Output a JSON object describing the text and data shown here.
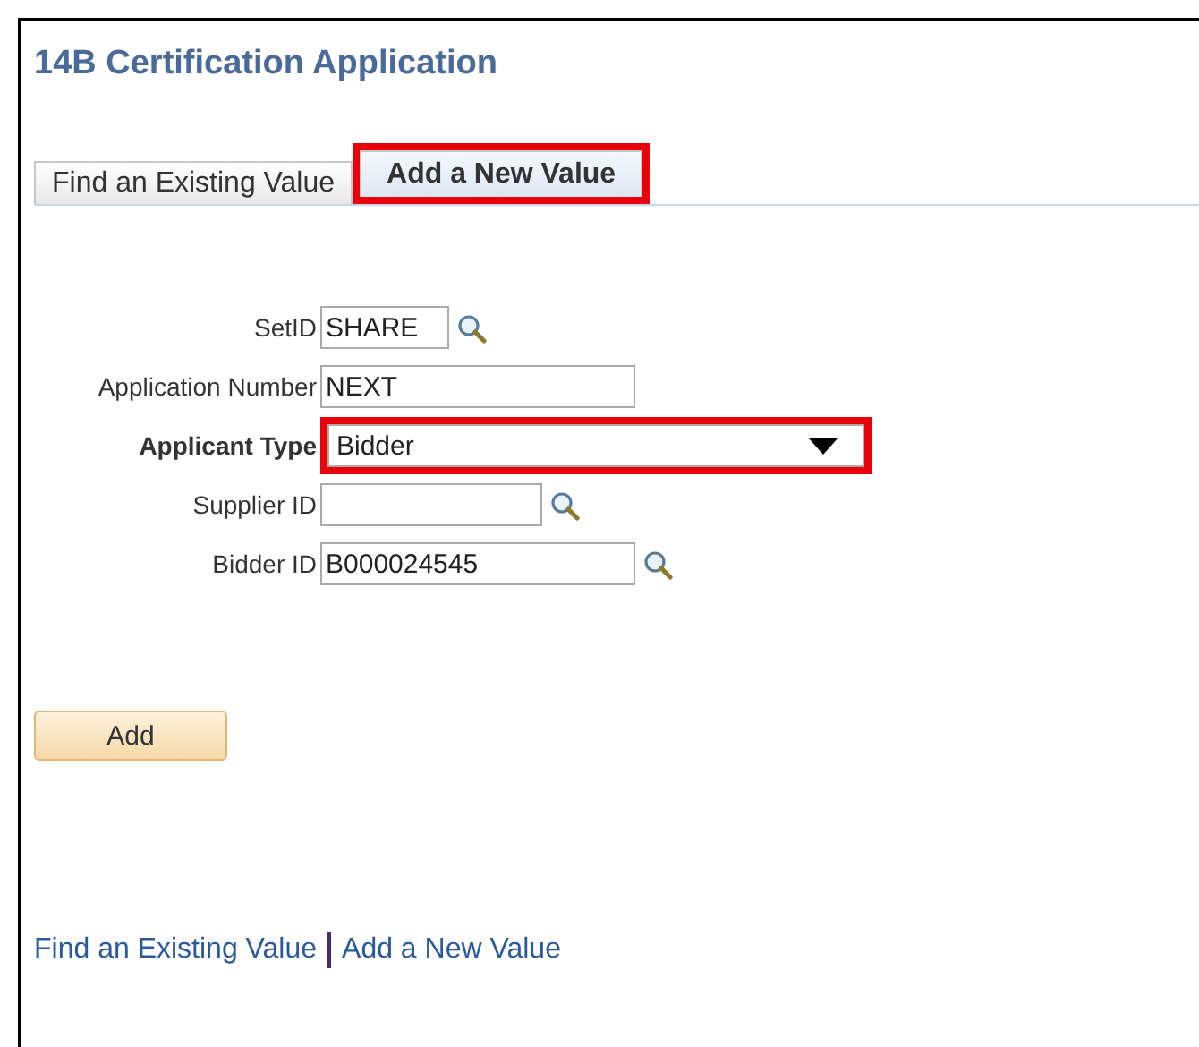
{
  "page_title": "14B Certification Application",
  "tabs": [
    {
      "label": "Find an Existing Value",
      "selected": false,
      "highlighted": false
    },
    {
      "label": "Add a New Value",
      "selected": true,
      "highlighted": true
    }
  ],
  "fields": [
    {
      "label": "SetID",
      "kind": "lookup",
      "value": "SHARE",
      "emphasized": false
    },
    {
      "label": "Application Number",
      "kind": "text",
      "value": "NEXT",
      "emphasized": false
    },
    {
      "label": "Applicant Type",
      "kind": "dropdown",
      "value": "Bidder",
      "emphasized": true,
      "highlighted": true
    },
    {
      "label": "Supplier ID",
      "kind": "lookup",
      "emphasized": false
    },
    {
      "label": "Bidder ID",
      "kind": "lookup",
      "value": "B000024545",
      "emphasized": false
    }
  ],
  "add_button": "Add",
  "footer_links": [
    "Find an Existing Value",
    "Add a New Value"
  ]
}
